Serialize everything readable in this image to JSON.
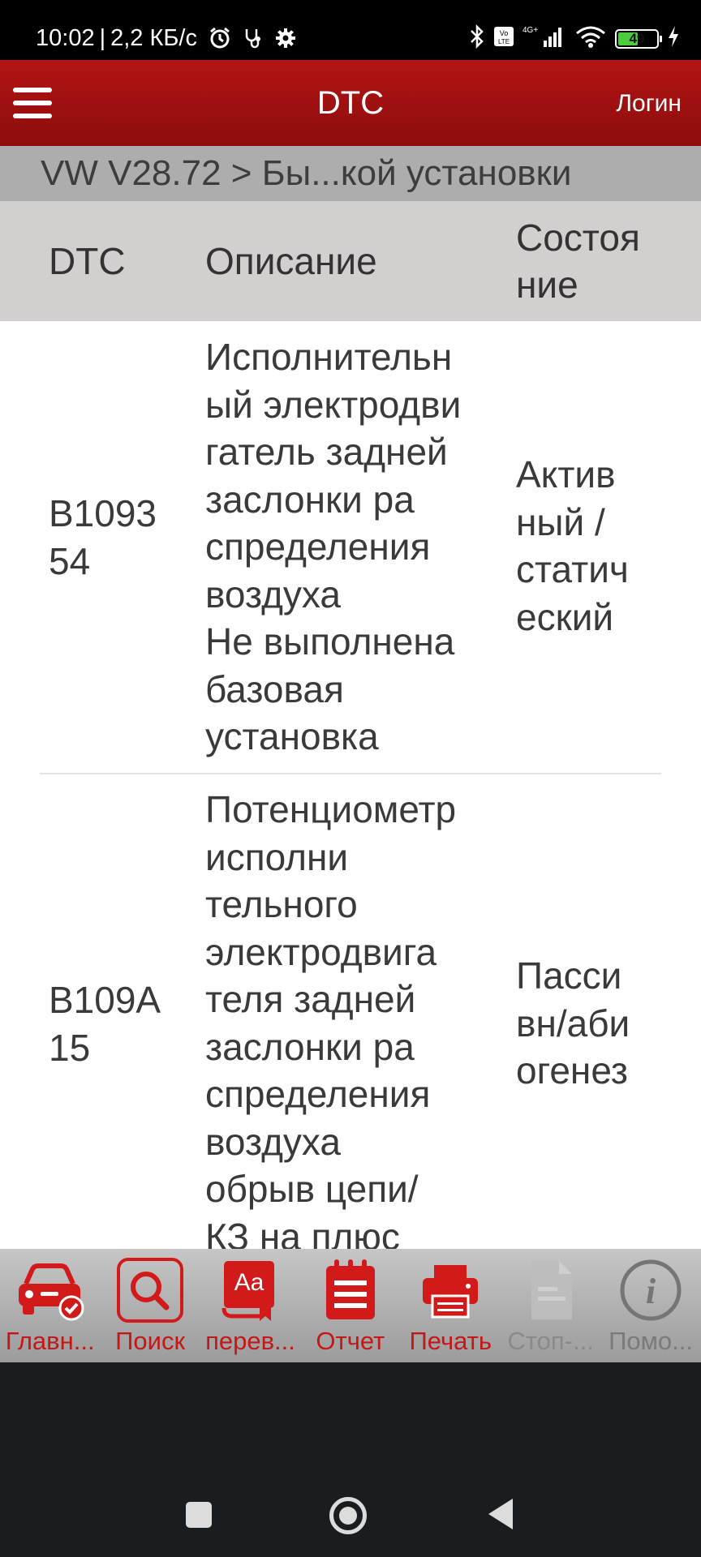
{
  "status_bar": {
    "time": "10:02",
    "separator": "|",
    "net_speed": "2,2 КБ/с",
    "battery": "49",
    "icons": [
      "alarm-icon",
      "stethoscope-icon",
      "gear-icon",
      "bluetooth-icon",
      "volte-icon",
      "signal-4g-icon",
      "wifi-icon",
      "battery-icon",
      "charging-icon"
    ]
  },
  "app_bar": {
    "title": "DTC",
    "login": "Логин"
  },
  "breadcrumb": "VW V28.72 > Бы...кой установки",
  "table": {
    "headers": {
      "code": "DTC",
      "description": "Описание",
      "status": [
        "Состоя",
        "ние"
      ]
    },
    "rows": [
      {
        "code": [
          "B1093",
          "54"
        ],
        "description": [
          "Исполнительн",
          "ый электродви",
          "гатель задней",
          "заслонки ра",
          "спределения",
          "воздуха",
          "Не выполнена",
          "базовая",
          "установка"
        ],
        "status": [
          "Актив",
          "ный /",
          "статич",
          "еский"
        ]
      },
      {
        "code": [
          "B109A",
          "15"
        ],
        "description": [
          "Потенциометр",
          "исполни",
          "тельного",
          "электродвига",
          "теля задней",
          "заслонки ра",
          "спределения",
          "воздуха",
          "обрыв цепи/",
          "КЗ на плюс"
        ],
        "status": [
          "Пасси",
          "вн/аби",
          "огенез"
        ]
      }
    ]
  },
  "toolbar": [
    {
      "label": "Главн...",
      "icon": "car-check-icon",
      "enabled": true
    },
    {
      "label": "Поиск",
      "icon": "search-icon",
      "enabled": true
    },
    {
      "label": "перев...",
      "icon": "translate-book-icon",
      "enabled": true
    },
    {
      "label": "Отчет",
      "icon": "report-notepad-icon",
      "enabled": true
    },
    {
      "label": "Печать",
      "icon": "printer-icon",
      "enabled": true
    },
    {
      "label": "Стоп-...",
      "icon": "freeze-frame-doc-icon",
      "enabled": false
    },
    {
      "label": "Помо...",
      "icon": "info-icon",
      "enabled": true
    }
  ],
  "colors": {
    "brand_red": "#b41414",
    "toolbar_red": "#c41717",
    "header_gray": "#d3cfcf",
    "breadcrumb_gray": "#adadad"
  }
}
